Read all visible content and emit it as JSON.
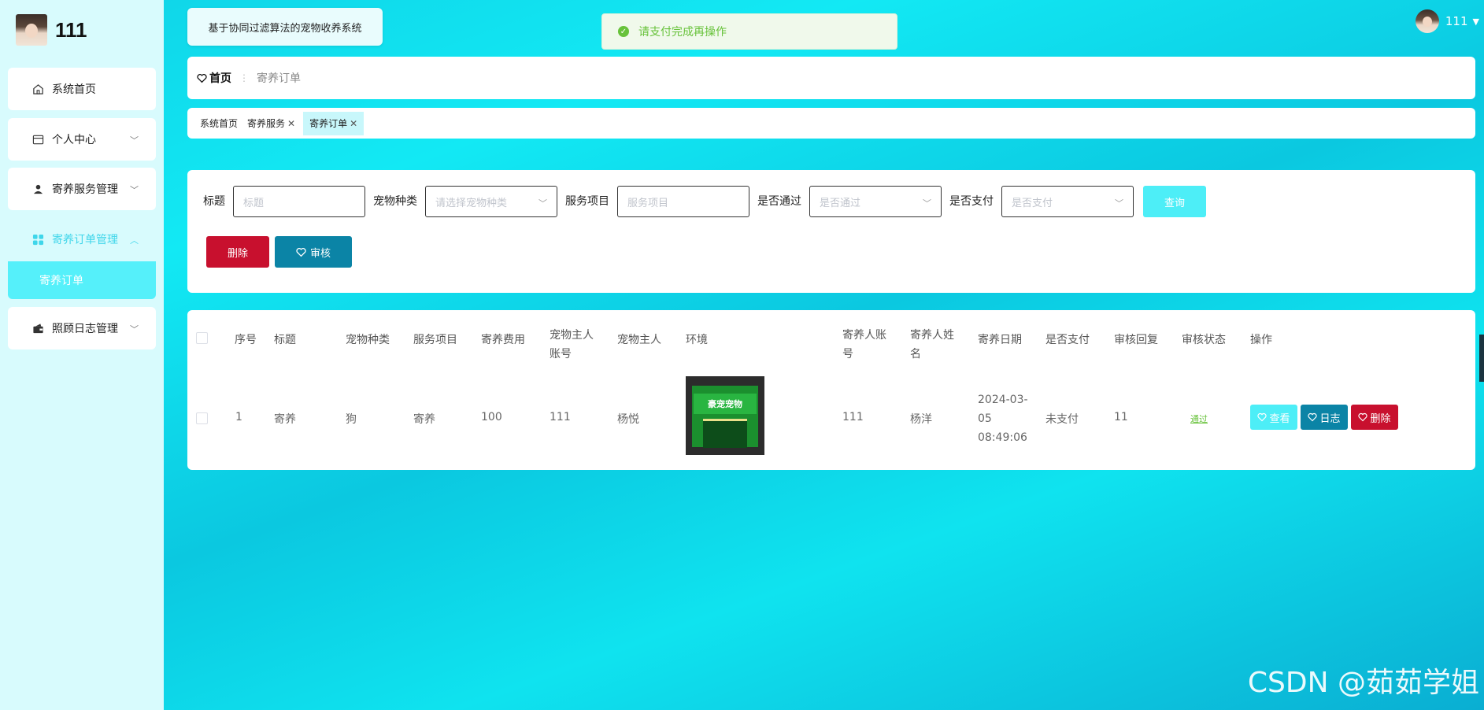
{
  "sidebar": {
    "username": "111",
    "menu": [
      {
        "label": "系统首页",
        "icon": "home-icon"
      },
      {
        "label": "个人中心",
        "icon": "profile-card-icon"
      },
      {
        "label": "寄养服务管理",
        "icon": "person-icon"
      },
      {
        "label": "寄养订单管理",
        "icon": "grid-icon"
      },
      {
        "label": "照顾日志管理",
        "icon": "wallet-icon"
      }
    ],
    "submenu_active": "寄养订单"
  },
  "header": {
    "system_title": "基于协同过滤算法的宠物收养系统",
    "toast_message": "请支付完成再操作",
    "top_username": "111"
  },
  "breadcrumb": {
    "home": "首页",
    "current": "寄养订单"
  },
  "tags": [
    {
      "label": "系统首页",
      "closable": false
    },
    {
      "label": "寄养服务",
      "closable": true
    },
    {
      "label": "寄养订单",
      "closable": true
    }
  ],
  "search": {
    "title_label": "标题",
    "title_placeholder": "标题",
    "pet_type_label": "宠物种类",
    "pet_type_placeholder": "请选择宠物种类",
    "service_label": "服务项目",
    "service_placeholder": "服务项目",
    "passed_label": "是否通过",
    "passed_placeholder": "是否通过",
    "paid_label": "是否支付",
    "paid_placeholder": "是否支付",
    "query_button": "查询",
    "delete_button": "删除",
    "audit_button": "审核"
  },
  "table": {
    "headers": [
      "序号",
      "标题",
      "宠物种类",
      "服务项目",
      "寄养费用",
      "宠物主人账号",
      "宠物主人",
      "环境",
      "寄养人账号",
      "寄养人姓名",
      "寄养日期",
      "是否支付",
      "审核回复",
      "审核状态",
      "操作"
    ],
    "rows": [
      {
        "index": "1",
        "title": "寄养",
        "pet_type": "狗",
        "service": "寄养",
        "fee": "100",
        "owner_account": "111",
        "owner": "杨悦",
        "env_sign": "豪宠宠物",
        "fosterer_account": "111",
        "fosterer_name": "杨洋",
        "date": "2024-03-05 08:49:06",
        "paid": "未支付",
        "reply": "11",
        "status": "通过",
        "actions": {
          "view": "查看",
          "log": "日志",
          "delete": "删除"
        }
      }
    ]
  },
  "watermark": "CSDN @茹茹学姐",
  "colors": {
    "accent": "#4deef7",
    "danger": "#c8102e",
    "primary_dark": "#0b84a6",
    "success": "#67c23a"
  }
}
